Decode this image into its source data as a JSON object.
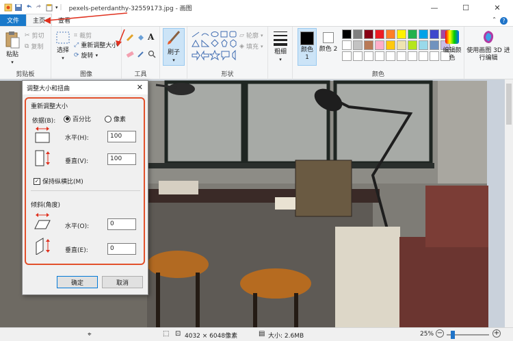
{
  "window": {
    "title": "pexels-peterdanthy-32559173.jpg - 画图"
  },
  "tabs": {
    "file": "文件",
    "home": "主页",
    "view": "查看"
  },
  "ribbon": {
    "clipboard": {
      "paste": "粘贴",
      "cut": "剪切",
      "copy": "复制",
      "label": "剪贴板"
    },
    "image": {
      "select": "选择",
      "crop": "裁剪",
      "resize": "重新调整大小",
      "rotate": "旋转",
      "label": "图像"
    },
    "tools": {
      "label": "工具",
      "text_tool": "A"
    },
    "brushes": {
      "label": "刷子"
    },
    "shapes": {
      "outline": "轮廓",
      "fill": "填充",
      "label": "形状"
    },
    "size": {
      "label": "粗细"
    },
    "colors": {
      "color1": "颜色 1",
      "color2": "颜色 2",
      "edit": "编辑颜色",
      "label": "颜色",
      "palette": [
        "#000000",
        "#7f7f7f",
        "#880015",
        "#ed1c24",
        "#ff7f27",
        "#fff200",
        "#22b14c",
        "#00a2e8",
        "#3f48cc",
        "#a349a4",
        "#ffffff",
        "#c3c3c3",
        "#b97a57",
        "#ffaec9",
        "#ffc90e",
        "#efe4b0",
        "#b5e61d",
        "#99d9ea",
        "#7092be",
        "#c8bfe7",
        "#ffffff",
        "#ffffff",
        "#ffffff",
        "#ffffff",
        "#ffffff",
        "#ffffff",
        "#ffffff",
        "#ffffff",
        "#ffffff",
        "#ffffff"
      ]
    },
    "paint3d": {
      "label": "使用画图 3D 进行编辑"
    }
  },
  "dialog": {
    "title": "调整大小和扭曲",
    "resize_section": "重新调整大小",
    "by_label": "依据(B):",
    "percent": "百分比",
    "pixels": "像素",
    "horizontal": "水平(H):",
    "horizontal_value": "100",
    "vertical": "垂直(V):",
    "vertical_value": "100",
    "keep_ratio": "保持纵横比(M)",
    "skew_section": "倾斜(角度)",
    "skew_h": "水平(O):",
    "skew_h_value": "0",
    "skew_v": "垂直(E):",
    "skew_v_value": "0",
    "ok": "确定",
    "cancel": "取消"
  },
  "status": {
    "dimensions": "4032 × 6048像素",
    "size": "大小: 2.6MB",
    "zoom": "25%",
    "zoom_level": 0.25
  }
}
